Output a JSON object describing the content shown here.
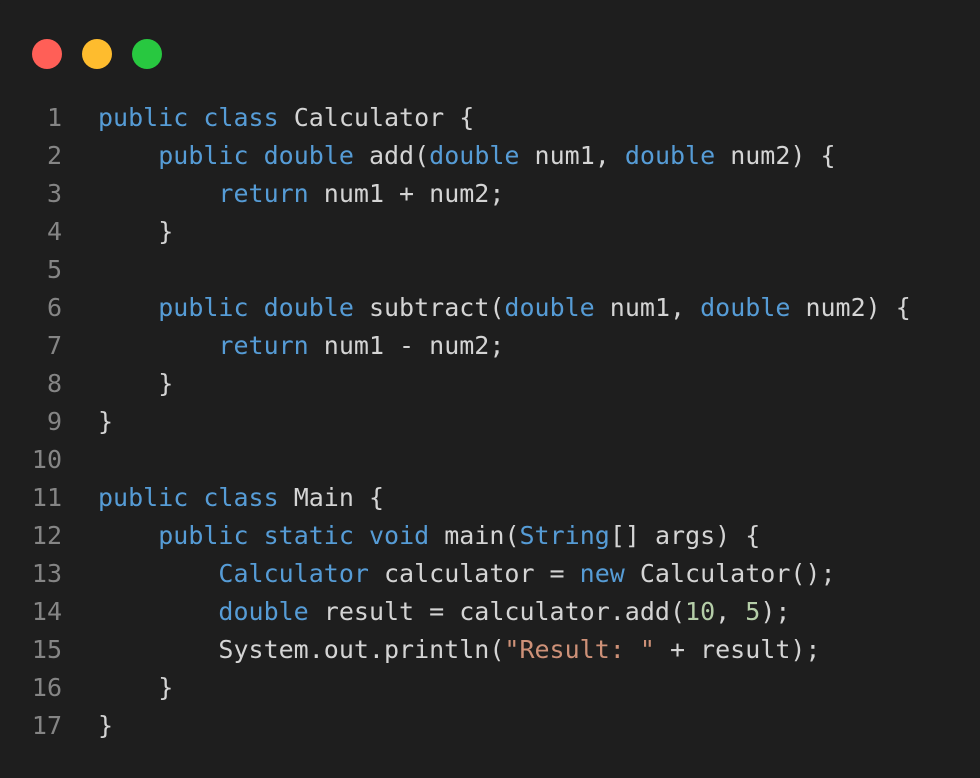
{
  "window": {
    "controls": [
      {
        "name": "close",
        "color": "#ff5f57"
      },
      {
        "name": "minimize",
        "color": "#febc2e"
      },
      {
        "name": "maximize",
        "color": "#28c840"
      }
    ]
  },
  "theme": {
    "background": "#1e1e1e",
    "text": "#d4d4d4",
    "keyword": "#569cd6",
    "string": "#ce9178",
    "number": "#b5cea8",
    "line_number": "#858585"
  },
  "code": {
    "language": "java",
    "lines": [
      {
        "n": "1",
        "tokens": [
          {
            "t": "kw",
            "v": "public"
          },
          {
            "t": "tx",
            "v": " "
          },
          {
            "t": "kw",
            "v": "class"
          },
          {
            "t": "tx",
            "v": " Calculator {"
          }
        ]
      },
      {
        "n": "2",
        "tokens": [
          {
            "t": "tx",
            "v": "    "
          },
          {
            "t": "kw",
            "v": "public"
          },
          {
            "t": "tx",
            "v": " "
          },
          {
            "t": "kw",
            "v": "double"
          },
          {
            "t": "tx",
            "v": " add("
          },
          {
            "t": "kw",
            "v": "double"
          },
          {
            "t": "tx",
            "v": " num1, "
          },
          {
            "t": "kw",
            "v": "double"
          },
          {
            "t": "tx",
            "v": " num2) {"
          }
        ]
      },
      {
        "n": "3",
        "tokens": [
          {
            "t": "tx",
            "v": "        "
          },
          {
            "t": "kw",
            "v": "return"
          },
          {
            "t": "tx",
            "v": " num1 + num2;"
          }
        ]
      },
      {
        "n": "4",
        "tokens": [
          {
            "t": "tx",
            "v": "    }"
          }
        ]
      },
      {
        "n": "5",
        "tokens": []
      },
      {
        "n": "6",
        "tokens": [
          {
            "t": "tx",
            "v": "    "
          },
          {
            "t": "kw",
            "v": "public"
          },
          {
            "t": "tx",
            "v": " "
          },
          {
            "t": "kw",
            "v": "double"
          },
          {
            "t": "tx",
            "v": " subtract("
          },
          {
            "t": "kw",
            "v": "double"
          },
          {
            "t": "tx",
            "v": " num1, "
          },
          {
            "t": "kw",
            "v": "double"
          },
          {
            "t": "tx",
            "v": " num2) {"
          }
        ]
      },
      {
        "n": "7",
        "tokens": [
          {
            "t": "tx",
            "v": "        "
          },
          {
            "t": "kw",
            "v": "return"
          },
          {
            "t": "tx",
            "v": " num1 - num2;"
          }
        ]
      },
      {
        "n": "8",
        "tokens": [
          {
            "t": "tx",
            "v": "    }"
          }
        ]
      },
      {
        "n": "9",
        "tokens": [
          {
            "t": "tx",
            "v": "}"
          }
        ]
      },
      {
        "n": "10",
        "tokens": []
      },
      {
        "n": "11",
        "tokens": [
          {
            "t": "kw",
            "v": "public"
          },
          {
            "t": "tx",
            "v": " "
          },
          {
            "t": "kw",
            "v": "class"
          },
          {
            "t": "tx",
            "v": " Main {"
          }
        ]
      },
      {
        "n": "12",
        "tokens": [
          {
            "t": "tx",
            "v": "    "
          },
          {
            "t": "kw",
            "v": "public"
          },
          {
            "t": "tx",
            "v": " "
          },
          {
            "t": "kw",
            "v": "static"
          },
          {
            "t": "tx",
            "v": " "
          },
          {
            "t": "kw",
            "v": "void"
          },
          {
            "t": "tx",
            "v": " main("
          },
          {
            "t": "kw",
            "v": "String"
          },
          {
            "t": "tx",
            "v": "[] args) {"
          }
        ]
      },
      {
        "n": "13",
        "tokens": [
          {
            "t": "tx",
            "v": "        "
          },
          {
            "t": "kw",
            "v": "Calculator"
          },
          {
            "t": "tx",
            "v": " calculator = "
          },
          {
            "t": "kw",
            "v": "new"
          },
          {
            "t": "tx",
            "v": " Calculator();"
          }
        ]
      },
      {
        "n": "14",
        "tokens": [
          {
            "t": "tx",
            "v": "        "
          },
          {
            "t": "kw",
            "v": "double"
          },
          {
            "t": "tx",
            "v": " result = calculator.add("
          },
          {
            "t": "num",
            "v": "10"
          },
          {
            "t": "tx",
            "v": ", "
          },
          {
            "t": "num",
            "v": "5"
          },
          {
            "t": "tx",
            "v": ");"
          }
        ]
      },
      {
        "n": "15",
        "tokens": [
          {
            "t": "tx",
            "v": "        System.out.println("
          },
          {
            "t": "str",
            "v": "\"Result: \""
          },
          {
            "t": "tx",
            "v": " + result);"
          }
        ]
      },
      {
        "n": "16",
        "tokens": [
          {
            "t": "tx",
            "v": "    }"
          }
        ]
      },
      {
        "n": "17",
        "tokens": [
          {
            "t": "tx",
            "v": "}"
          }
        ]
      }
    ]
  }
}
